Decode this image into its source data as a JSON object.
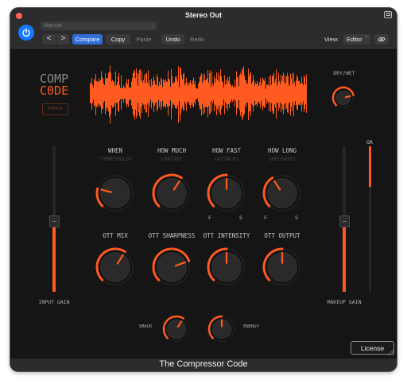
{
  "window": {
    "title": "Stereo Out"
  },
  "toolbar": {
    "preset_value": "Manual",
    "back_label": "<",
    "forward_label": ">",
    "compare_label": "Compare",
    "copy_label": "Copy",
    "paste_label": "Paste",
    "undo_label": "Undo",
    "redo_label": "Redo",
    "view_label": "View:",
    "view_value": "Editor"
  },
  "plugin": {
    "logo_line1": "COMP",
    "logo_line2": "C0DE",
    "bypass_label": "BYPASS",
    "dry_wet": {
      "label": "DRY/WET",
      "value": 0.78
    },
    "knobs_row1": [
      {
        "title": "WHEN",
        "subtitle": "(THRESHOLD)",
        "value": 0.22
      },
      {
        "title": "HOW MUCH",
        "subtitle": "(RATIO)",
        "value": 0.62
      },
      {
        "title": "HOW FAST",
        "subtitle": "(ATTACK)",
        "value": 0.5,
        "min_label": "F",
        "max_label": "S"
      },
      {
        "title": "HOW LONG",
        "subtitle": "(RELEASE)",
        "value": 0.38,
        "min_label": "F",
        "max_label": "S"
      }
    ],
    "knobs_row2": [
      {
        "title": "OTT MIX",
        "value": 0.62
      },
      {
        "title": "OTT SHARPNESS",
        "value": 0.76
      },
      {
        "title": "OTT INTENSITY",
        "value": 0.5
      },
      {
        "title": "OTT OUTPUT",
        "value": 0.5
      }
    ],
    "input_gain": {
      "label": "INPUT GAIN",
      "value": 0.46
    },
    "makeup_gain": {
      "label": "MAKEUP GAIN",
      "value": 0.46
    },
    "gr_meter": {
      "label": "GR",
      "value": 0.28
    },
    "smack": {
      "label": "SMACK",
      "value": 0.62
    },
    "energy": {
      "label": "ENERGY",
      "value": 0.5
    },
    "license_label": "License"
  },
  "footer": {
    "title": "The Compressor Code"
  },
  "colors": {
    "accent": "#ff5a1f",
    "background": "#151515",
    "chrome": "#2c2c2e",
    "power": "#1479ff"
  }
}
